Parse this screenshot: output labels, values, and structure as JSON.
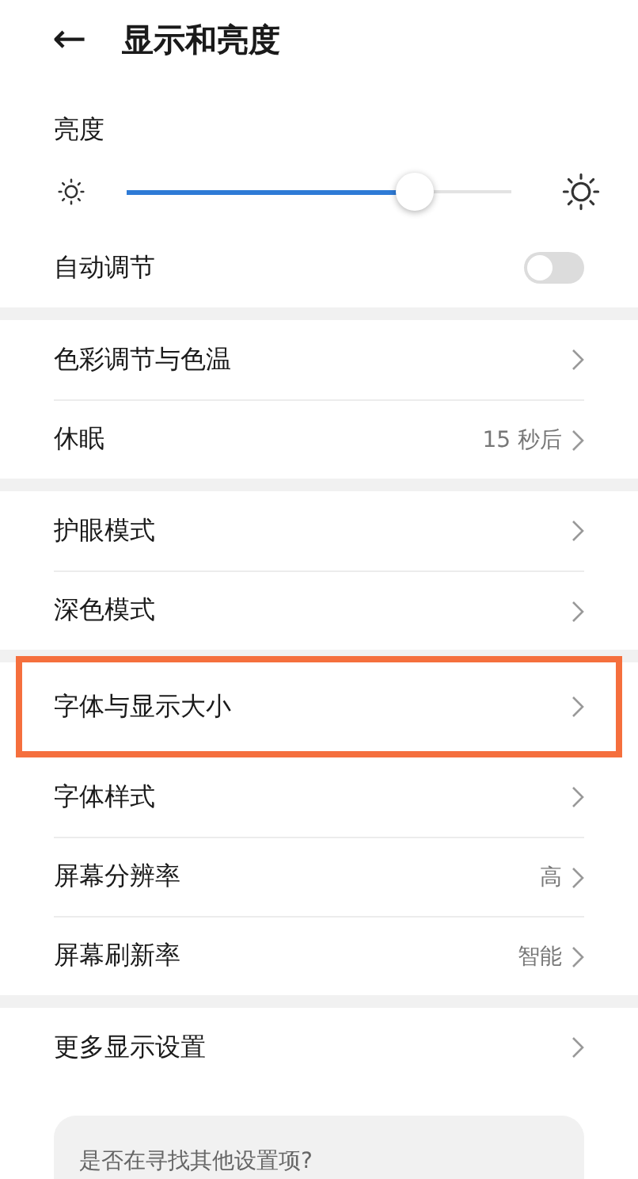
{
  "header": {
    "back": "←",
    "title": "显示和亮度"
  },
  "brightness": {
    "label": "亮度",
    "level": 0.75
  },
  "auto_adjust": {
    "label": "自动调节",
    "on": false
  },
  "sections": [
    {
      "items": [
        {
          "label": "色彩调节与色温",
          "value": "",
          "highlighted": false
        },
        {
          "label": "休眠",
          "value": "15 秒后",
          "highlighted": false
        }
      ]
    },
    {
      "items": [
        {
          "label": "护眼模式",
          "value": "",
          "highlighted": false
        },
        {
          "label": "深色模式",
          "value": "",
          "highlighted": false
        }
      ]
    },
    {
      "items": [
        {
          "label": "字体与显示大小",
          "value": "",
          "highlighted": true
        },
        {
          "label": "字体样式",
          "value": "",
          "highlighted": false
        },
        {
          "label": "屏幕分辨率",
          "value": "高",
          "highlighted": false
        },
        {
          "label": "屏幕刷新率",
          "value": "智能",
          "highlighted": false
        }
      ]
    },
    {
      "items": [
        {
          "label": "更多显示设置",
          "value": "",
          "highlighted": false
        }
      ]
    }
  ],
  "suggestion": {
    "title": "是否在寻找其他设置项?"
  }
}
